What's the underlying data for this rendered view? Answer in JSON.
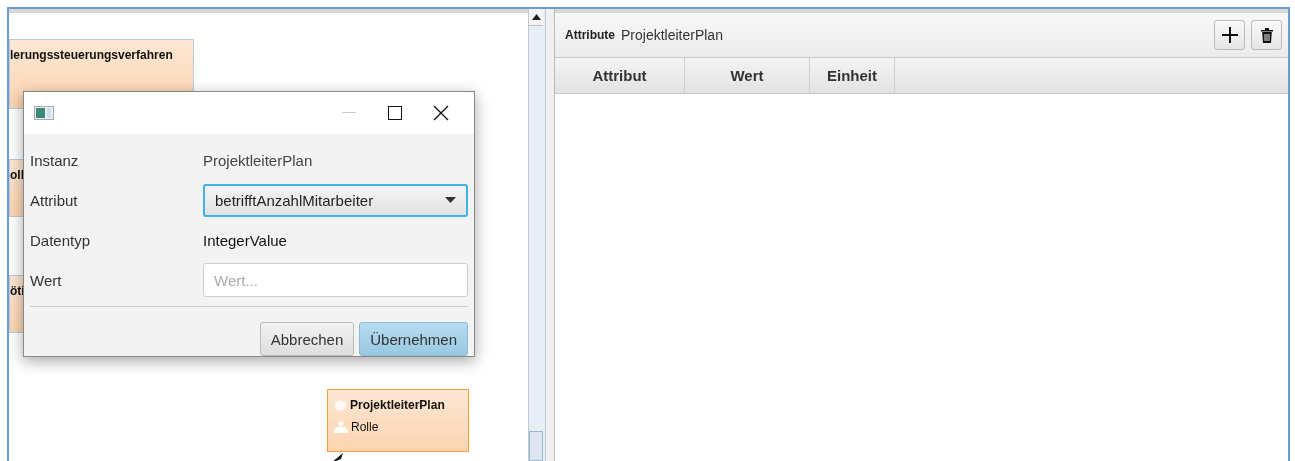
{
  "canvas": {
    "nodes": [
      {
        "kind": "partial",
        "label": "lerungssteuerungsverfahren"
      },
      {
        "kind": "partial",
        "label": "oll"
      },
      {
        "kind": "partial",
        "label": "öti"
      },
      {
        "kind": "instance",
        "label": "ProjektleiterPlan",
        "type_label": "Rolle",
        "selected": true
      }
    ]
  },
  "dialog": {
    "rows": [
      {
        "kind": "text",
        "label": "Instanz",
        "value": "ProjektleiterPlan",
        "muted": true
      },
      {
        "kind": "select",
        "label": "Attribut",
        "value": "betrifftAnzahlMitarbeiter",
        "focused": true
      },
      {
        "kind": "text",
        "label": "Datentyp",
        "value": "IntegerValue",
        "muted": false
      },
      {
        "kind": "input",
        "label": "Wert",
        "placeholder": "Wert..."
      }
    ],
    "buttons": [
      {
        "label": "Abbrechen",
        "default": false
      },
      {
        "label": "Übernehmen",
        "default": true
      }
    ]
  },
  "attributes": {
    "title": "Attribute",
    "instance": "ProjektleiterPlan",
    "columns": [
      "Attribut",
      "Wert",
      "Einheit"
    ]
  }
}
